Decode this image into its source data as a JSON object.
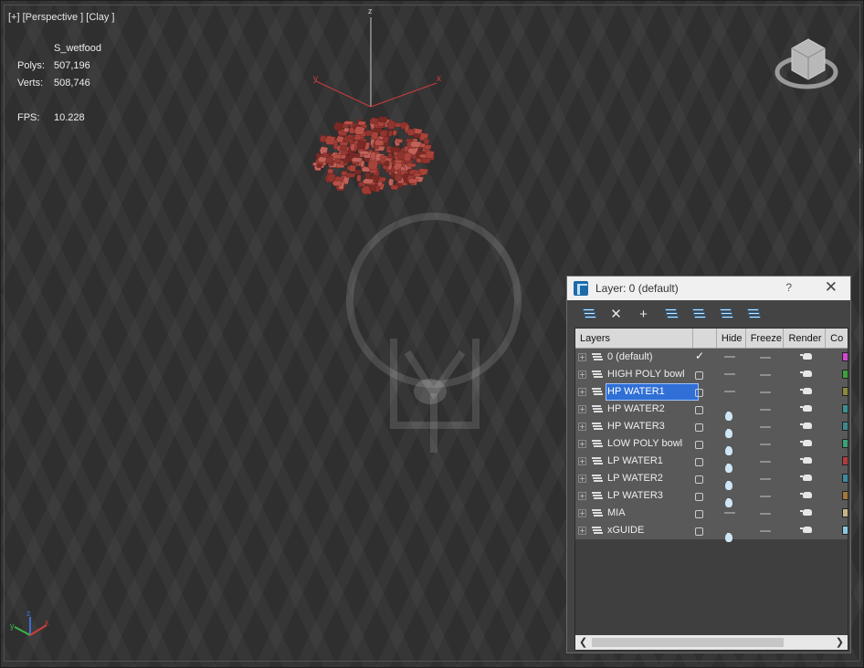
{
  "viewport": {
    "label": "[+] [Perspective ] [Clay ]",
    "stats": {
      "object": "S_wetfood",
      "polys_label": "Polys:",
      "polys_value": "507,196",
      "verts_label": "Verts:",
      "verts_value": "508,746",
      "fps_label": "FPS:",
      "fps_value": "10.228"
    },
    "axis": {
      "x": "x",
      "y": "y",
      "z": "z"
    },
    "viewcube_icon": "viewcube-icon",
    "colors": {
      "stats": "#e8c44a",
      "axis_x": "#d23b3b",
      "axis_y": "#3bb34a",
      "axis_z": "#3b6fd2",
      "food": "#a8433a"
    }
  },
  "dialog": {
    "title": "Layer: 0 (default)",
    "help": "?",
    "close": "✕",
    "toolbar": {
      "icons": [
        "new-layer-icon",
        "delete-layer-icon",
        "add-to-layer-icon",
        "select-objects-icon",
        "highlight-layer-icon",
        "hide-all-icon",
        "freeze-all-icon"
      ]
    },
    "columns": {
      "layers": "Layers",
      "hide": "Hide",
      "freeze": "Freeze",
      "render": "Render",
      "color": "Co"
    },
    "layers": [
      {
        "name": "0 (default)",
        "current": true,
        "hide": "dash",
        "color": "#d04ad0"
      },
      {
        "name": "HIGH POLY bowl",
        "current": false,
        "hide": "dash",
        "color": "#3ca03c"
      },
      {
        "name": "HP WATER1",
        "current": false,
        "hide": "dash",
        "selected": true,
        "color": "#8a8a3c"
      },
      {
        "name": "HP WATER2",
        "current": false,
        "hide": "bulb",
        "color": "#3c9090"
      },
      {
        "name": "HP WATER3",
        "current": false,
        "hide": "bulb",
        "color": "#3c8a8a"
      },
      {
        "name": "LOW POLY bowl",
        "current": false,
        "hide": "bulb",
        "color": "#3ca078"
      },
      {
        "name": "LP WATER1",
        "current": false,
        "hide": "bulb",
        "color": "#b03c3c"
      },
      {
        "name": "LP WATER2",
        "current": false,
        "hide": "bulb",
        "color": "#3c8aa0"
      },
      {
        "name": "LP WATER3",
        "current": false,
        "hide": "bulb",
        "color": "#a0783c"
      },
      {
        "name": "MIA",
        "current": false,
        "hide": "dash",
        "color": "#c8b48a"
      },
      {
        "name": "xGUIDE",
        "current": false,
        "hide": "bulb",
        "color": "#8ac8e0"
      }
    ],
    "scroll": {
      "left": "❮",
      "right": "❯"
    }
  }
}
